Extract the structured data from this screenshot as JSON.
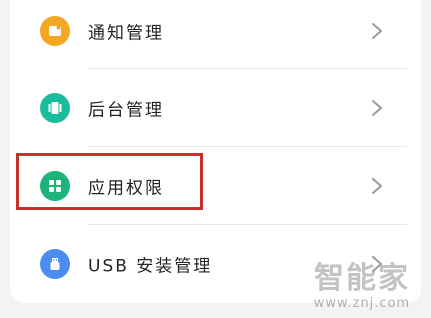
{
  "settings_list": {
    "items": [
      {
        "label": "通知管理",
        "icon": "notification-icon",
        "icon_color": "#f5a623"
      },
      {
        "label": "后台管理",
        "icon": "background-app-icon",
        "icon_color": "#1abc9c"
      },
      {
        "label": "应用权限",
        "icon": "grid-apps-icon",
        "icon_color": "#1db37a"
      },
      {
        "label": "USB 安装管理",
        "icon": "usb-icon",
        "icon_color": "#4a8cf0"
      }
    ]
  },
  "highlight_color": "#c9302c",
  "watermark": {
    "title": "智能家",
    "url": "www.znj.com"
  }
}
